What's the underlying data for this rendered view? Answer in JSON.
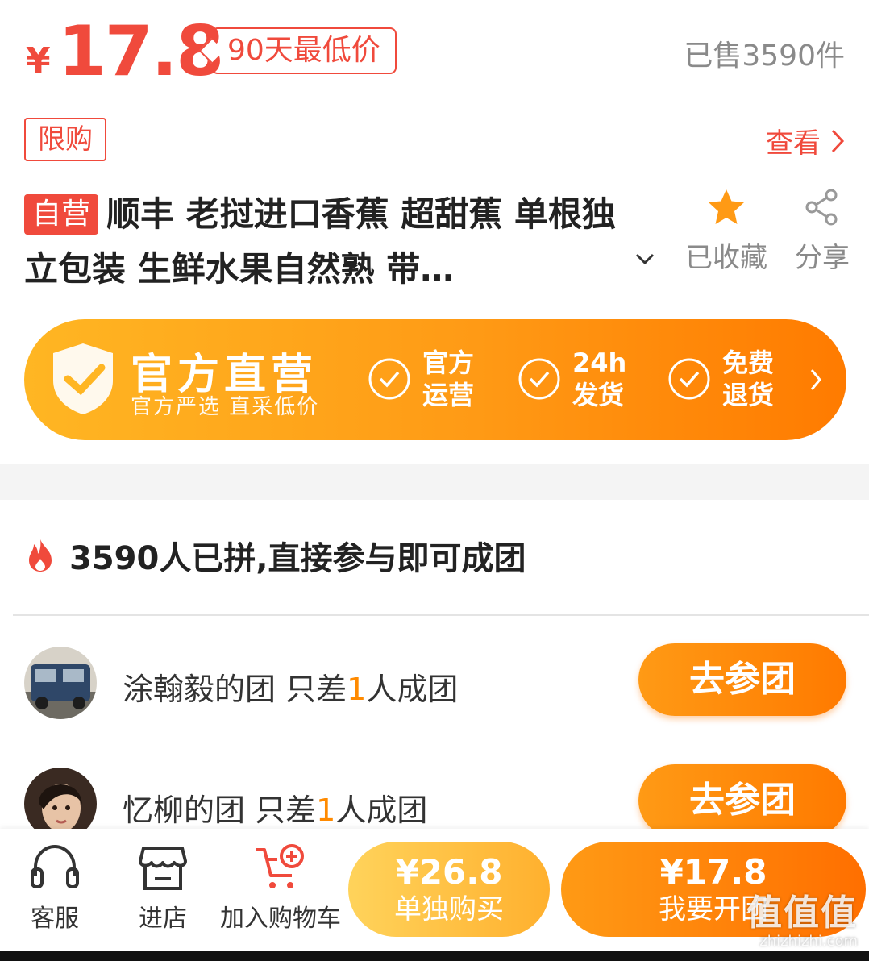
{
  "price": {
    "currency": "¥",
    "value": "17.8",
    "low_tag": "90天最低价",
    "sold": "已售3590件"
  },
  "limit": {
    "tag": "限购",
    "view_label": "查看"
  },
  "product": {
    "badge": "自营",
    "title": "顺丰 老挝进口香蕉 超甜蕉 单根独立包装 生鲜水果自然熟 带…",
    "fav_label": "已收藏",
    "share_label": "分享"
  },
  "banner": {
    "title": "官方直营",
    "subtitle": "官方严选 直采低价",
    "features": [
      {
        "line1": "官方",
        "line2": "运营"
      },
      {
        "line1": "24h",
        "line2": "发货"
      },
      {
        "line1": "免费",
        "line2": "退货"
      }
    ]
  },
  "group": {
    "header": "3590人已拼,直接参与即可成团",
    "rows": [
      {
        "name": "涂翰毅的团",
        "pre": "只差",
        "num": "1",
        "post": "人成团",
        "button": "去参团"
      },
      {
        "name": "忆柳的团",
        "pre": "只差",
        "num": "1",
        "post": "人成团",
        "button": "去参团"
      }
    ]
  },
  "bottom": {
    "service": "客服",
    "store": "进店",
    "cart": "加入购物车",
    "single_price": "¥26.8",
    "single_label": "单独购买",
    "group_price": "¥17.8",
    "group_label": "我要开团"
  },
  "watermark": {
    "main": "值值值",
    "sub": "zhizhizhi.com"
  },
  "colors": {
    "accent": "#f04a3c",
    "orange": "#ff8a00"
  }
}
